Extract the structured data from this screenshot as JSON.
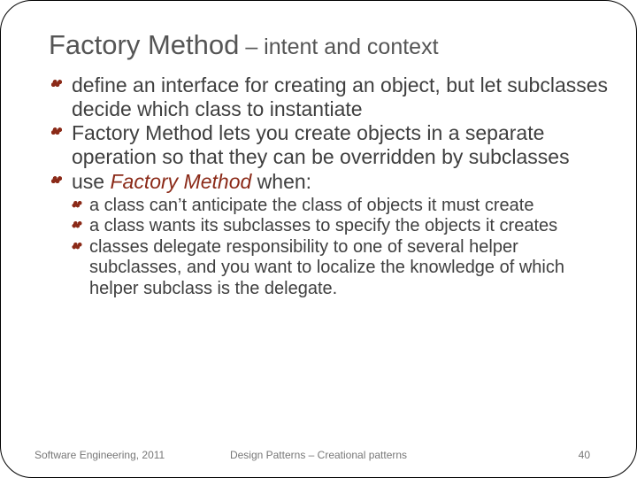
{
  "title_main": "Factory Method",
  "title_sep": " – ",
  "title_sub": "intent and context",
  "bullets": [
    {
      "text": "define an interface for creating an object, but let subclasses decide which class to instantiate"
    },
    {
      "text": "Factory Method lets you create objects in a separate operation so that they can be overridden by subclasses"
    },
    {
      "prefix": "use ",
      "em": "Factory Method",
      "suffix": " when:"
    }
  ],
  "sub_bullets": [
    "a class can’t anticipate the class of objects it must create",
    "a class wants its subclasses to specify the objects it creates",
    "classes delegate responsibility to one of several helper subclasses, and you want to localize the knowledge of which helper subclass is the delegate."
  ],
  "footer": {
    "left": "Software Engineering, 2011",
    "center": "Design Patterns – Creational patterns",
    "right": "40"
  }
}
